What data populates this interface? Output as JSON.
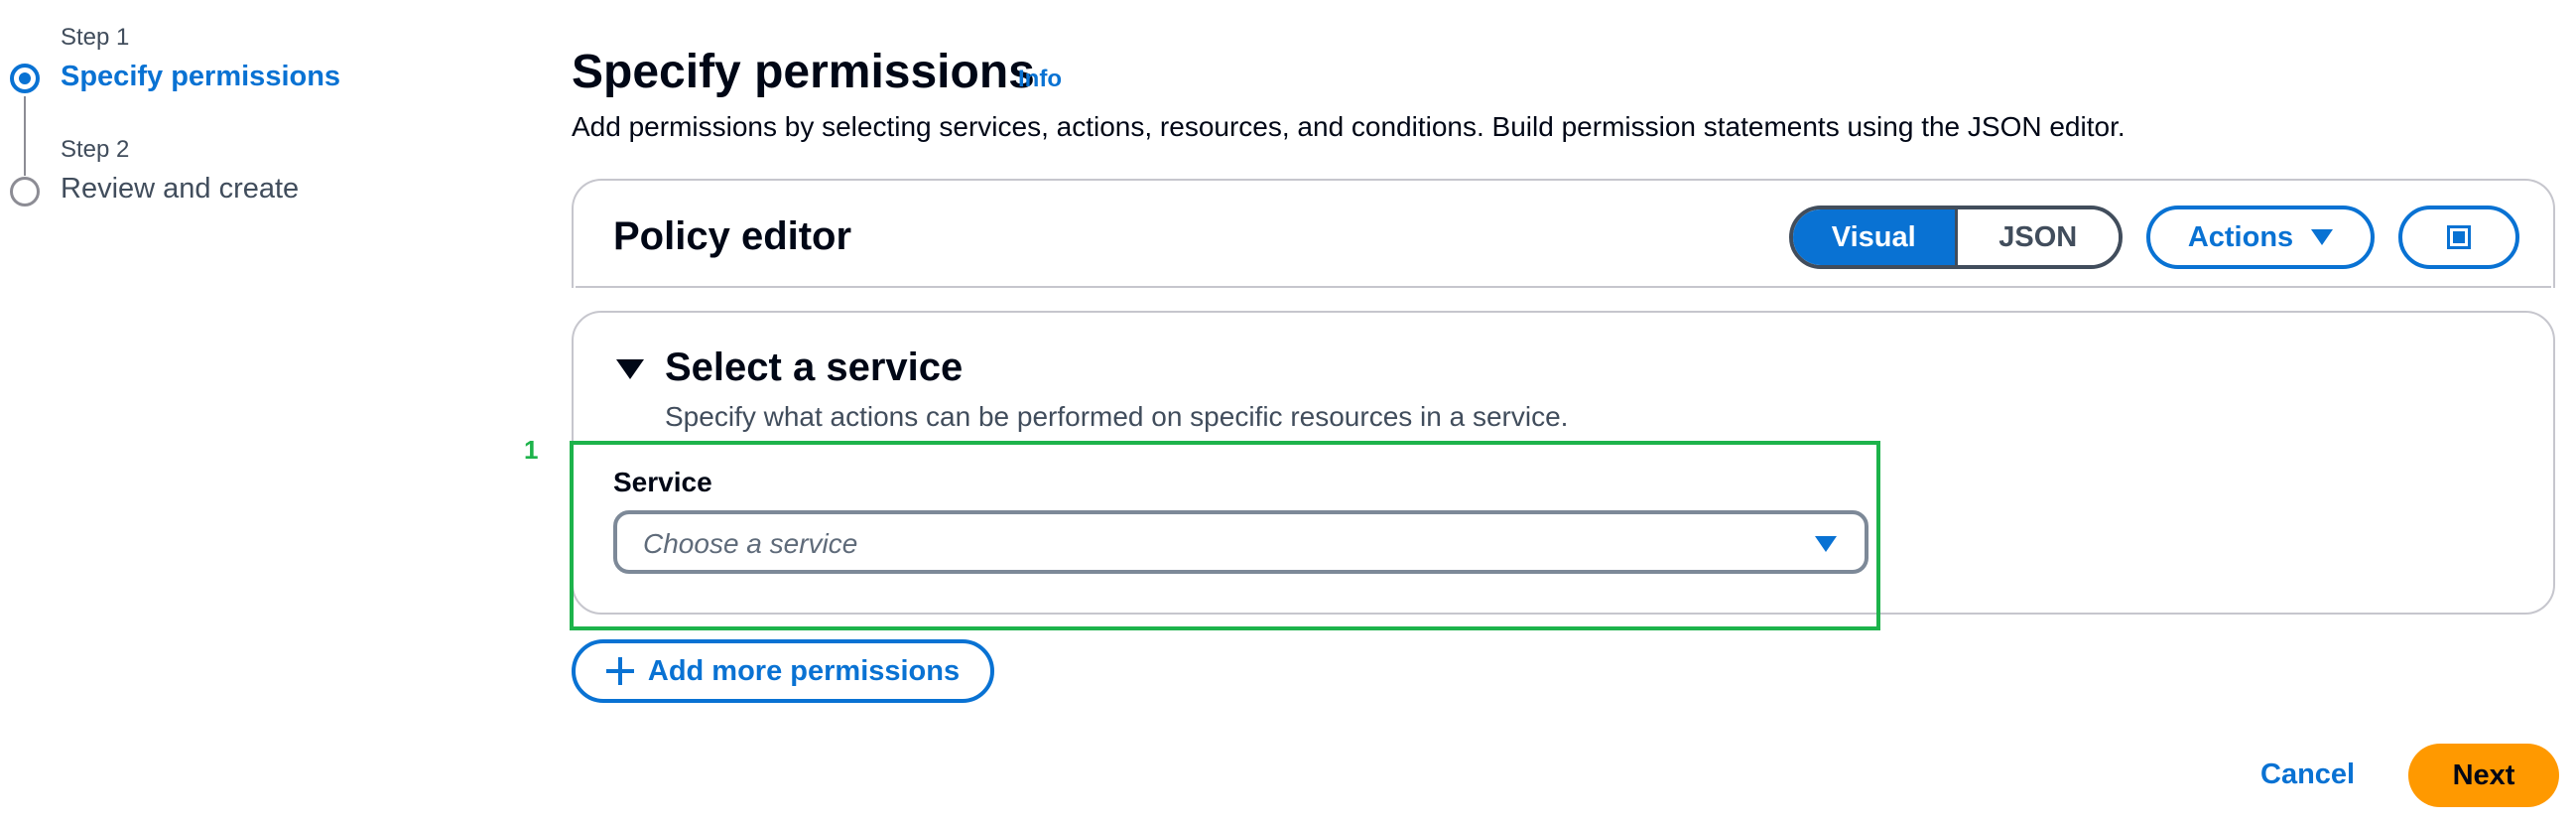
{
  "wizard": {
    "steps": [
      {
        "number": "Step 1",
        "label": "Specify permissions",
        "active": true
      },
      {
        "number": "Step 2",
        "label": "Review and create",
        "active": false
      }
    ]
  },
  "header": {
    "title": "Specify permissions",
    "info": "Info",
    "description": "Add permissions by selecting services, actions, resources, and conditions. Build permission statements using the JSON editor."
  },
  "policy_editor": {
    "title": "Policy editor",
    "modes": [
      "Visual",
      "JSON"
    ],
    "selected_mode": "Visual",
    "actions_label": "Actions"
  },
  "service_section": {
    "title": "Select a service",
    "description": "Specify what actions can be performed on specific resources in a service.",
    "field_label": "Service",
    "select_placeholder": "Choose a service"
  },
  "highlight": {
    "number": "1",
    "color": "#1db34b"
  },
  "add_permissions_label": "Add more permissions",
  "footer": {
    "cancel_label": "Cancel",
    "next_label": "Next"
  },
  "colors": {
    "accent": "#0972d3",
    "primary_button": "#ff9900",
    "text": "#000716"
  },
  "icons": {
    "step_active": "radio-selected-icon",
    "step_inactive": "radio-empty-icon",
    "actions": "caret-down-icon",
    "fullscreen": "fullscreen-icon",
    "collapse": "caret-down-filled-icon",
    "select": "caret-down-icon",
    "add": "plus-icon"
  }
}
